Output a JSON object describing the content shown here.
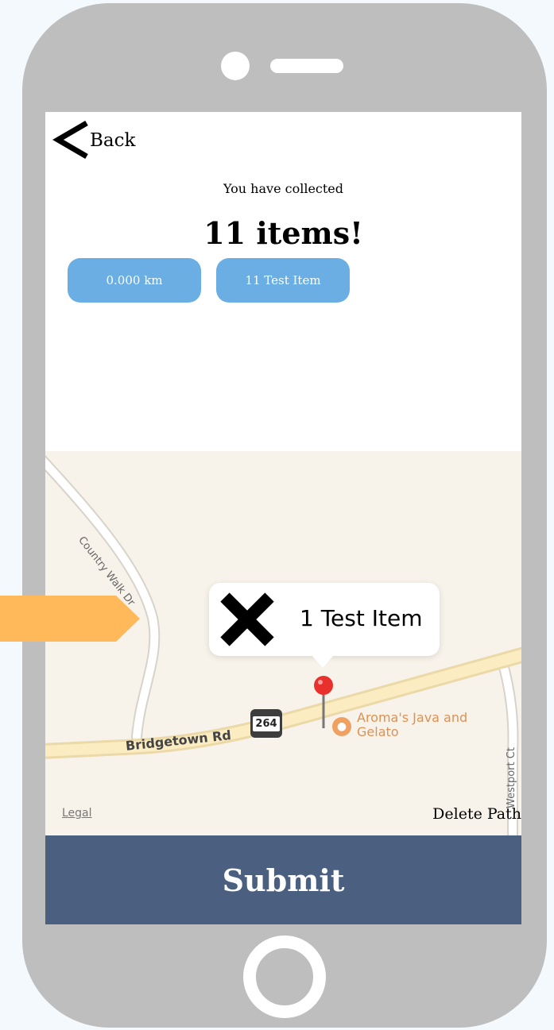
{
  "header": {
    "back_label": "Back"
  },
  "summary": {
    "collected_text": "You have collected",
    "items_title": "11 items!",
    "distance_label": "0.000 km",
    "items_label": "11 Test Item"
  },
  "map": {
    "street_country_walk": "Country Walk Dr",
    "street_bridgetown": "Bridgetown Rd",
    "street_westport": "Westport Ct",
    "route_number": "264",
    "poi_name": "Aroma's Java and Gelato",
    "callout_title": "1 Test Item",
    "legal_label": "Legal",
    "delete_path_label": "Delete Path"
  },
  "footer": {
    "submit_label": "Submit"
  },
  "colors": {
    "pill_blue": "#6aaee3",
    "submit_navy": "#4b5f80",
    "arrow_orange": "#ffb95a",
    "pin_red": "#e8302c",
    "phone_gray": "#bebebe"
  }
}
